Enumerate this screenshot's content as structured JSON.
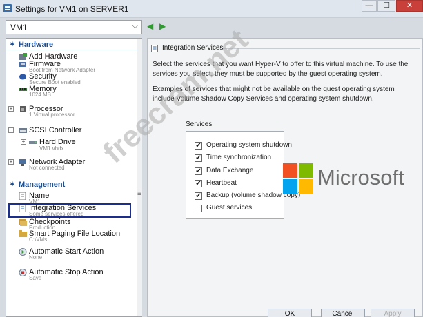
{
  "window": {
    "title": "Settings for VM1 on SERVER1",
    "min_glyph": "—",
    "max_glyph": "☐",
    "close_glyph": "✕"
  },
  "vm_selector": {
    "value": "VM1",
    "chevron": "⌵"
  },
  "nav": {
    "back": "◀",
    "forward": "▶"
  },
  "sidebar": {
    "hardware": {
      "header": "Hardware",
      "items": [
        {
          "label": "Add Hardware",
          "sub": "",
          "icon": "add-hardware-icon"
        },
        {
          "label": "Firmware",
          "sub": "Boot from Network Adapter",
          "icon": "firmware-icon"
        },
        {
          "label": "Security",
          "sub": "Secure Boot enabled",
          "icon": "shield-icon"
        },
        {
          "label": "Memory",
          "sub": "1024 MB",
          "icon": "memory-icon"
        },
        {
          "label": "Processor",
          "sub": "1 Virtual processor",
          "icon": "processor-icon"
        },
        {
          "label": "SCSI Controller",
          "sub": "",
          "icon": "scsi-icon"
        },
        {
          "label": "Hard Drive",
          "sub": "VM1.vhdx",
          "icon": "hard-drive-icon"
        },
        {
          "label": "Network Adapter",
          "sub": "Not connected",
          "icon": "network-adapter-icon"
        }
      ]
    },
    "management": {
      "header": "Management",
      "items": [
        {
          "label": "Name",
          "sub": "VM1",
          "icon": "name-icon"
        },
        {
          "label": "Integration Services",
          "sub": "Some services offered",
          "icon": "integration-services-icon"
        },
        {
          "label": "Checkpoints",
          "sub": "Production",
          "icon": "checkpoints-icon"
        },
        {
          "label": "Smart Paging File Location",
          "sub": "C:\\VMs",
          "icon": "smart-paging-icon"
        },
        {
          "label": "Automatic Start Action",
          "sub": "None",
          "icon": "automatic-start-icon"
        },
        {
          "label": "Automatic Stop Action",
          "sub": "Save",
          "icon": "automatic-stop-icon"
        }
      ]
    },
    "scroll_glyph": "≡"
  },
  "panel": {
    "header": "Integration Services",
    "para1": "Select the services that you want Hyper-V to offer to this virtual machine. To use the services you select, they must be supported by the guest operating system.",
    "para2": "Examples of services that might not be available on the guest operating system include Volume Shadow Copy Services and operating system shutdown.",
    "services_label": "Services",
    "services": [
      {
        "label": "Operating system shutdown",
        "checked": "✔"
      },
      {
        "label": "Time synchronization",
        "checked": "✔"
      },
      {
        "label": "Data Exchange",
        "checked": "✔"
      },
      {
        "label": "Heartbeat",
        "checked": "✔"
      },
      {
        "label": "Backup (volume shadow copy)",
        "checked": "✔"
      },
      {
        "label": "Guest services",
        "checked": ""
      }
    ]
  },
  "brand": {
    "text": "Microsoft",
    "colors": {
      "red": "#f25022",
      "green": "#7fba00",
      "blue": "#00a4ef",
      "yellow": "#ffb900"
    }
  },
  "watermark": "freecram.net",
  "buttons": {
    "ok": "OK",
    "cancel": "Cancel",
    "apply": "Apply"
  },
  "colors": {
    "accent": "#1f4e8c",
    "selection": "#1a2e8f",
    "close": "#c9403a"
  }
}
